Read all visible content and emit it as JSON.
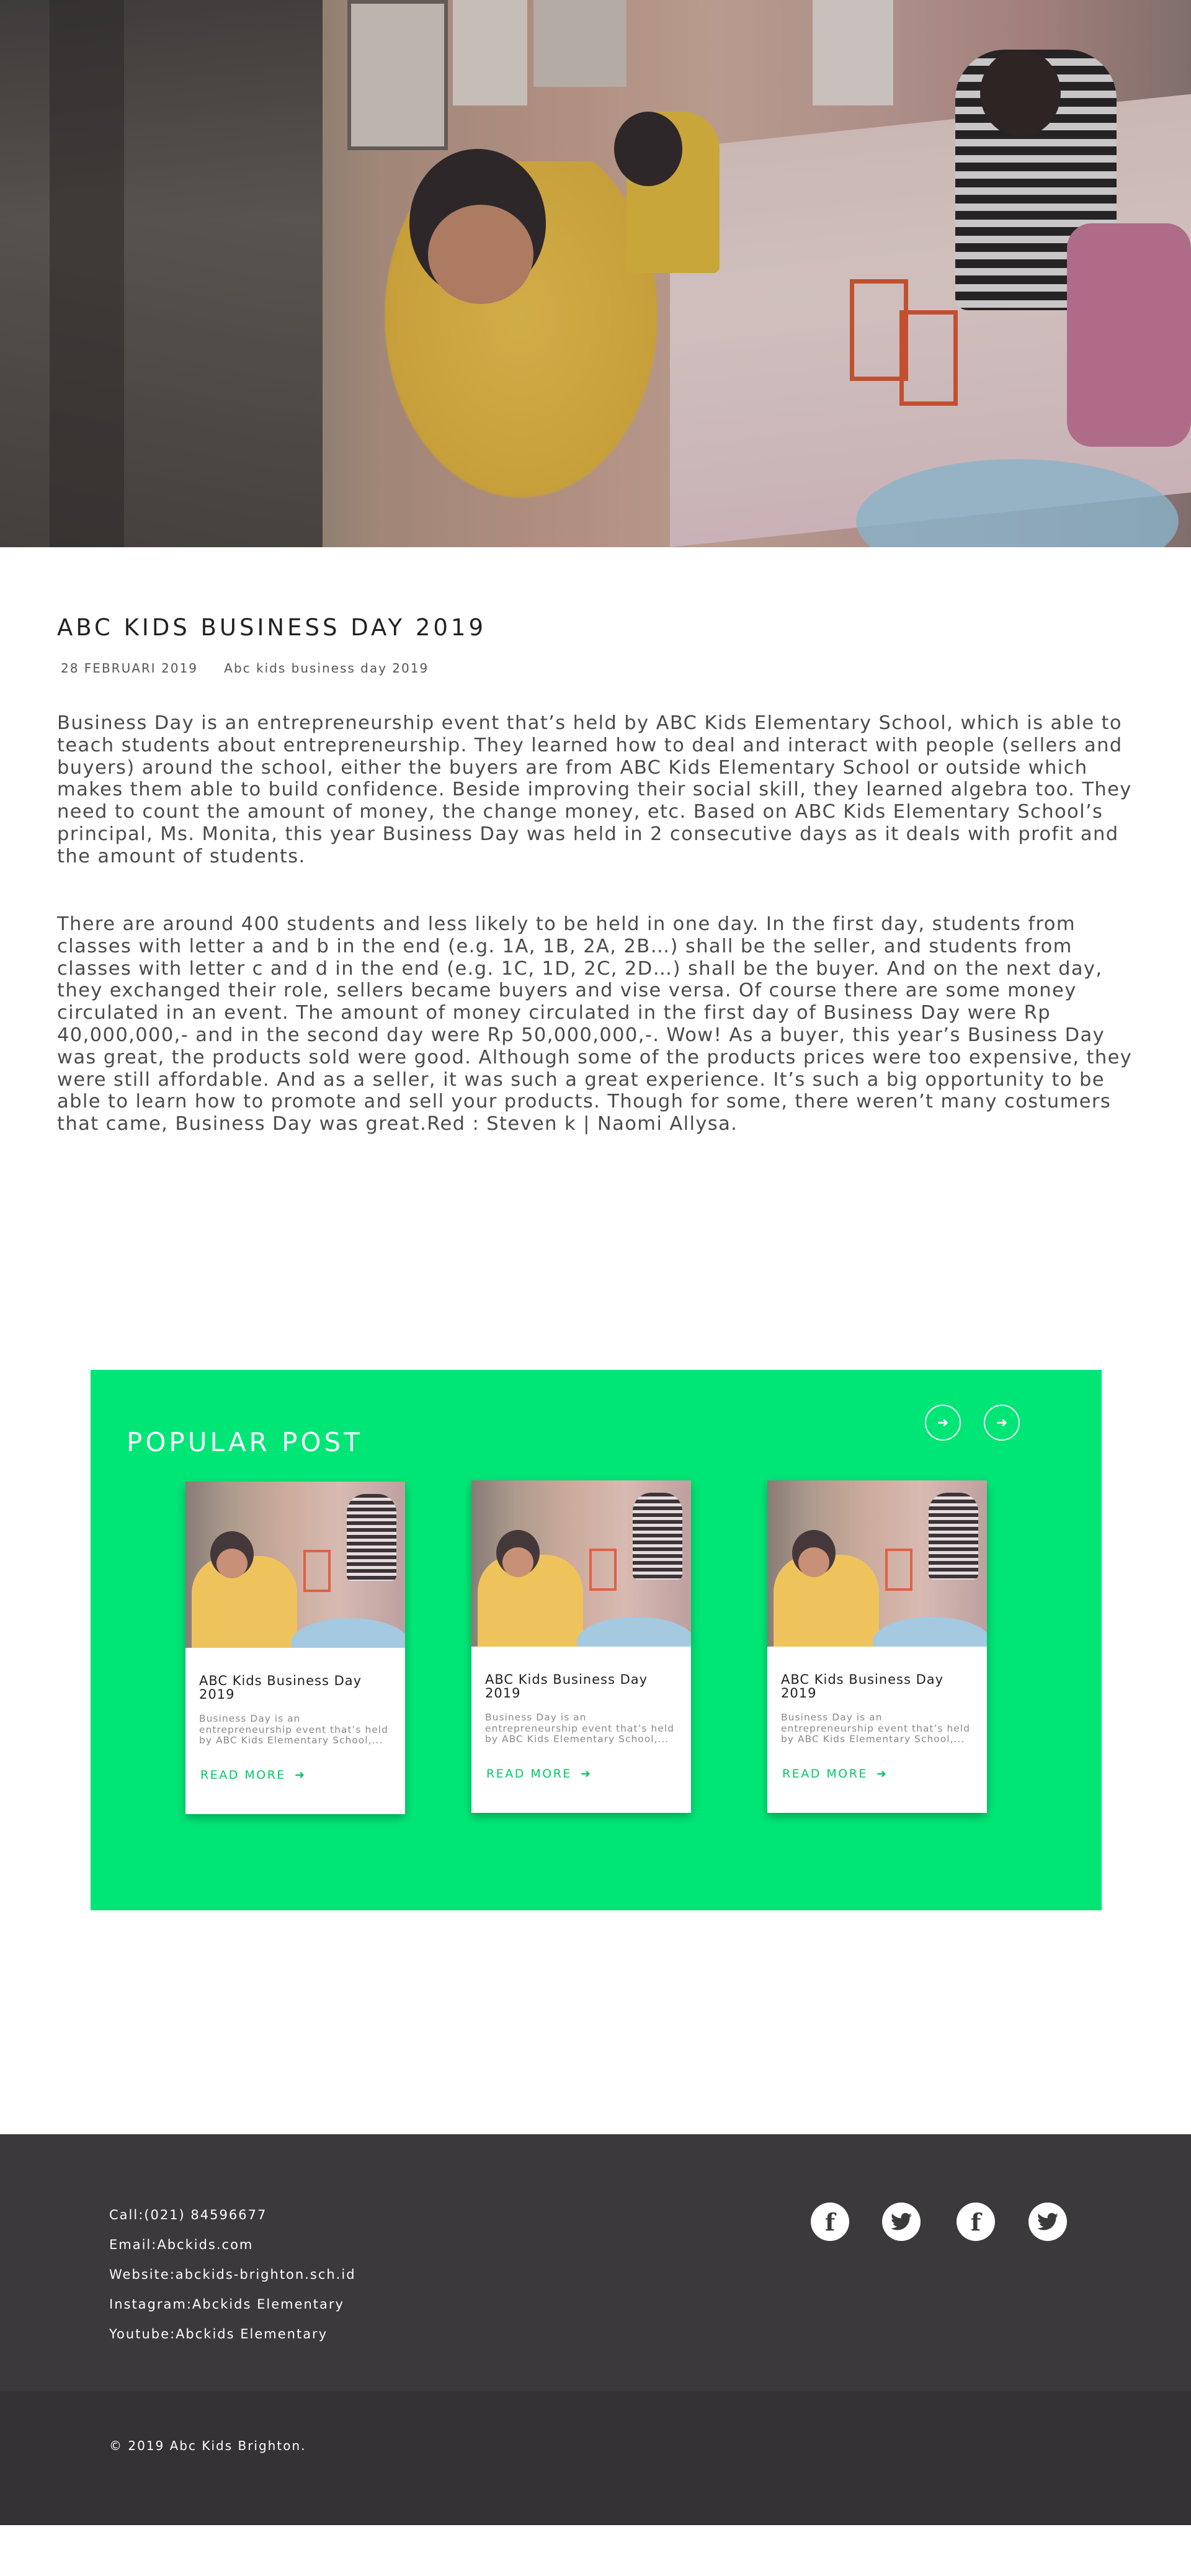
{
  "article": {
    "title": "ABC KIDS BUSINESS DAY 2019",
    "date": "28 FEBRUARI 2019",
    "category": "Abc kids business day 2019",
    "paragraph1": "Business Day is an entrepreneurship event that’s held by ABC Kids Elementary School, which is able to teach students about entrepreneurship. They learned how to deal and interact with people (sellers and buyers) around the school, either the buyers are from ABC Kids Elementary School or outside which makes them able to build confidence. Beside improving their social skill, they learned algebra too. They need to count the amount of money, the change money, etc. Based on ABC Kids Elementary School’s principal, Ms. Monita, this year Business Day was held in 2 consecutive days as it deals with profit and the amount of students.",
    "paragraph2": "There are around 400 students and less likely to be held in one day. In the first day, students from classes with letter a and b in the end (e.g. 1A, 1B, 2A, 2B…) shall be the seller, and students from classes with letter c and d in the end (e.g. 1C, 1D, 2C, 2D…) shall be the buyer. And on the next day, they exchanged their role, sellers became buyers and vise versa. Of course there are some money circulated in an event. The amount of money circulated in the first day of Business Day were Rp 40,000,000,- and in the second day were Rp 50,000,000,-. Wow! As a buyer, this year’s Business Day was great, the products sold were good. Although some of the products prices were too expensive, they were still affordable. And as a seller, it was such a great experience. It’s such a big opportunity to be able to learn how to promote and sell your products. Though for some, there weren’t many costumers that came, Business Day was great.Red : Steven k | Naomi Allysa."
  },
  "popular": {
    "heading": "POPULAR POST",
    "prev_icon": "arrow-left-icon",
    "next_icon": "arrow-right-icon",
    "accent_color": "#00e676",
    "cards": [
      {
        "title": "ABC Kids Business Day 2019",
        "excerpt": "Business Day is an entrepreneurship event that’s held by ABC Kids Elementary School,...",
        "more": "READ MORE"
      },
      {
        "title": "ABC Kids Business Day 2019",
        "excerpt": "Business Day is an entrepreneurship event that’s held by ABC Kids Elementary School,...",
        "more": "READ MORE"
      },
      {
        "title": "ABC Kids Business Day 2019",
        "excerpt": "Business Day is an entrepreneurship event that’s held by ABC Kids Elementary School,...",
        "more": "READ MORE"
      }
    ]
  },
  "footer": {
    "call": "Call:(021) 84596677",
    "email": "Email:Abckids.com",
    "website": "Website:abckids-brighton.sch.id",
    "instagram": "Instagram:Abckids Elementary",
    "youtube": "Youtube:Abckids Elementary",
    "social_icons": [
      "facebook-icon",
      "twitter-icon",
      "facebook-icon",
      "twitter-icon"
    ],
    "copyright": "© 2019 Abc Kids Brighton."
  }
}
